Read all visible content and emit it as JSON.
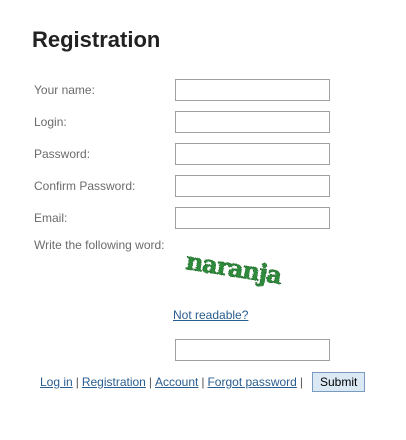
{
  "page_title": "Registration",
  "form": {
    "name_label": "Your name:",
    "name_value": "",
    "login_label": "Login:",
    "login_value": "",
    "password_label": "Password:",
    "password_value": "",
    "confirm_label": "Confirm Password:",
    "confirm_value": "",
    "email_label": "Email:",
    "email_value": "",
    "captcha_label": "Write the following word:",
    "captcha_word": "naranja",
    "not_readable_link": "Not readable?",
    "captcha_value": ""
  },
  "footer": {
    "links": [
      "Log in",
      "Registration",
      "Account",
      "Forgot password"
    ],
    "separator": "|",
    "submit_label": "Submit"
  },
  "colors": {
    "link": "#2a5d8f",
    "label": "#6b6b6b",
    "captcha": "#2e8b3a",
    "submit_bg": "#dbe9f5"
  }
}
